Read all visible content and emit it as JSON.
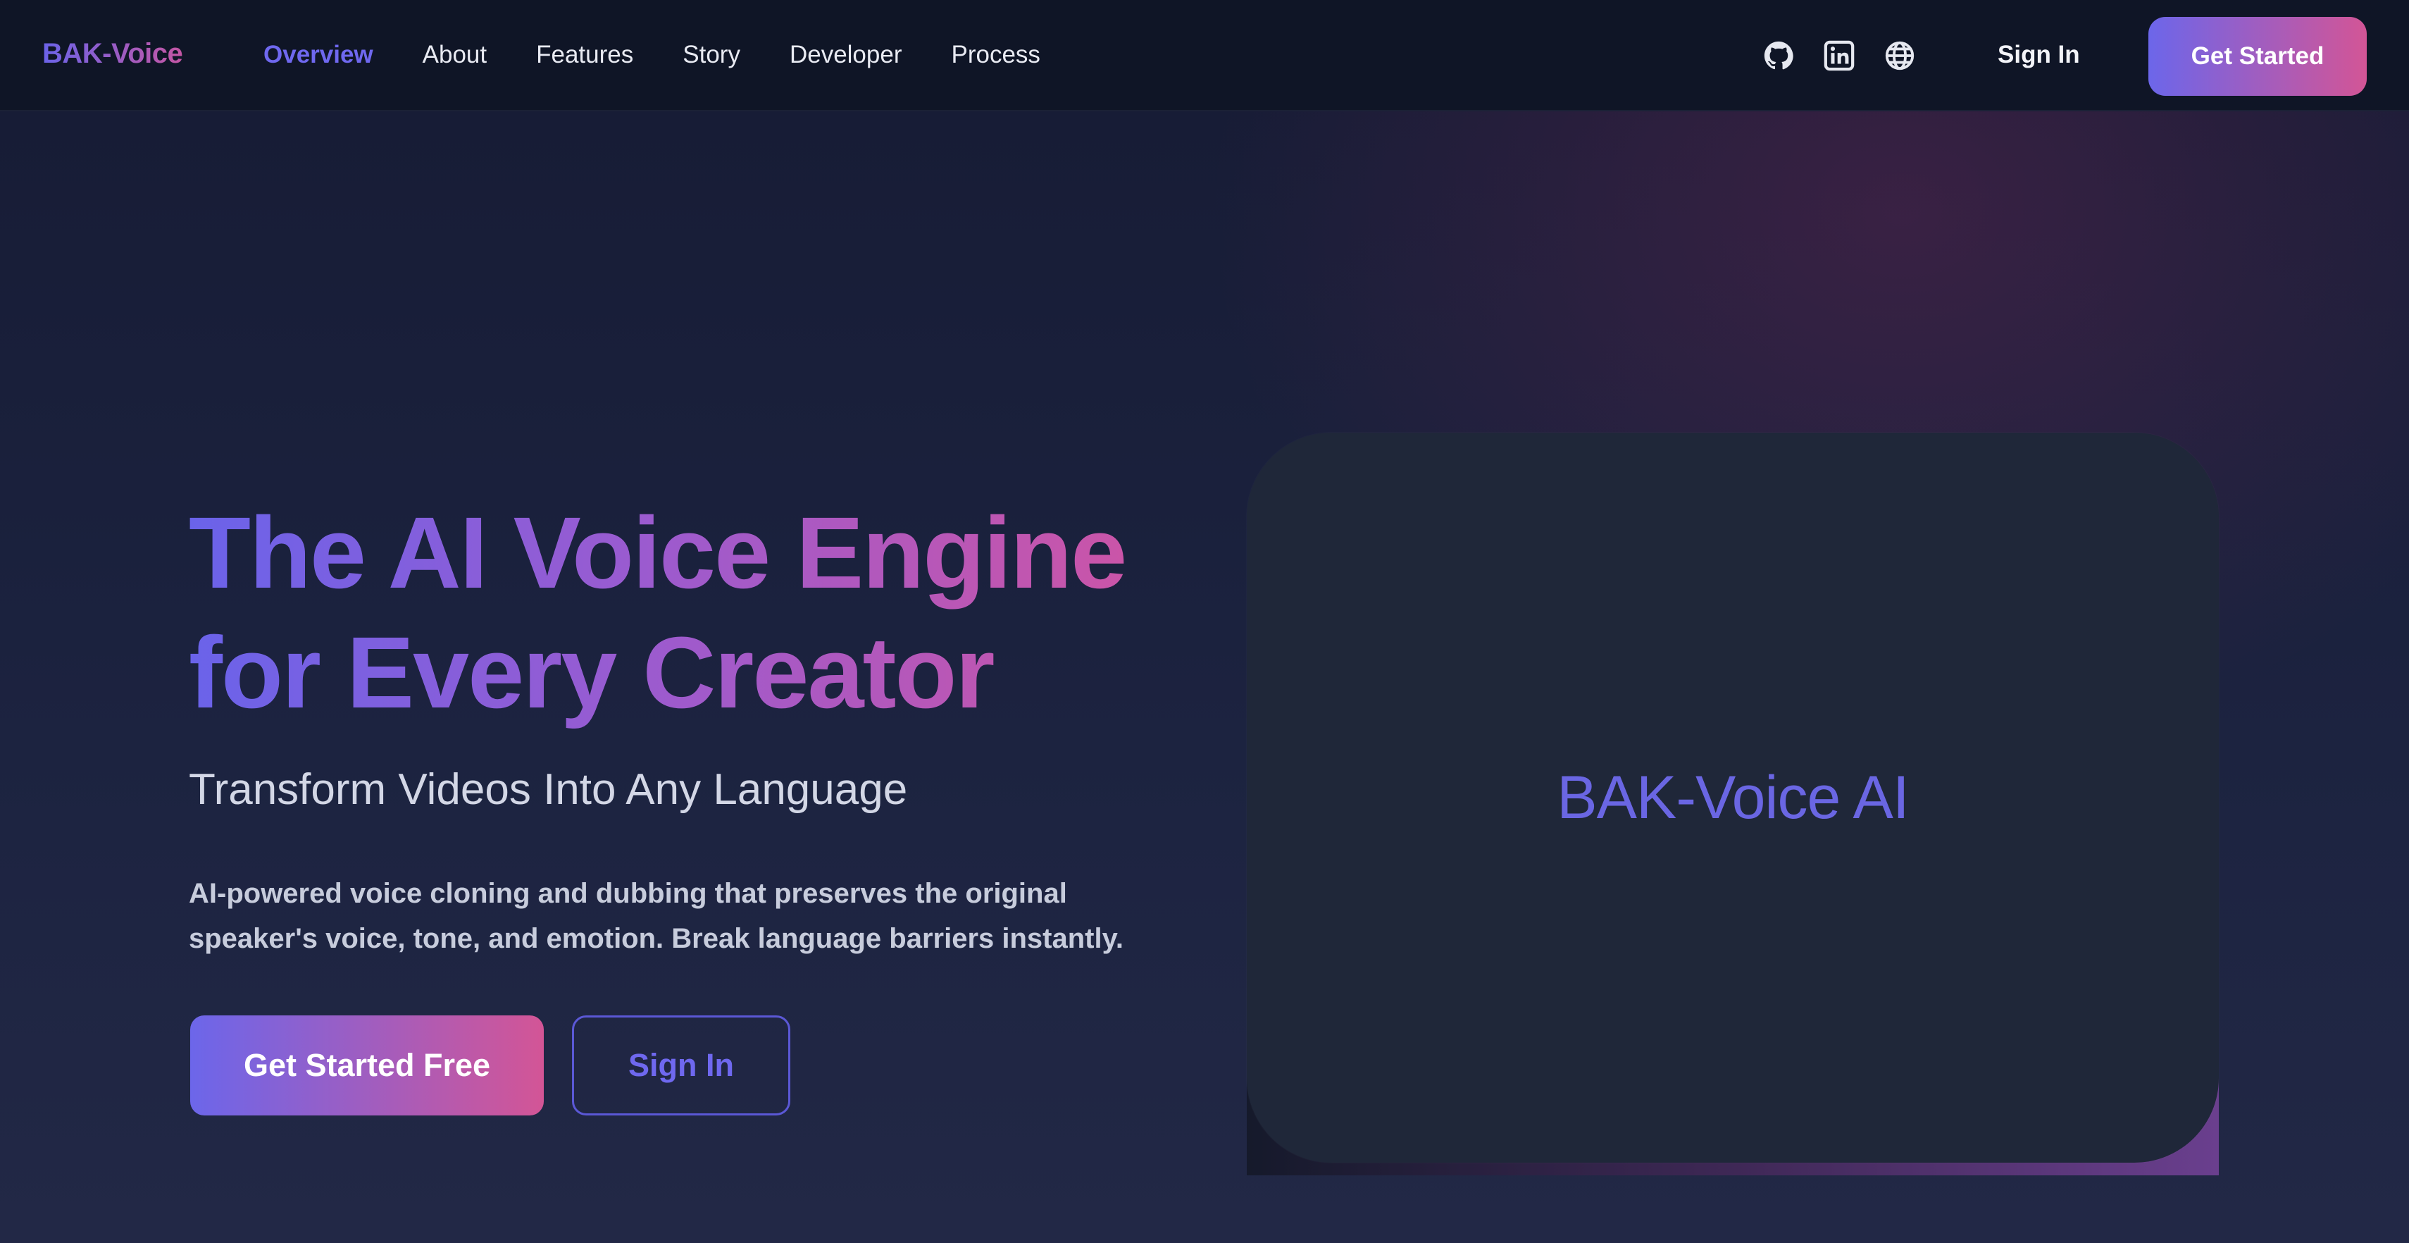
{
  "nav": {
    "logo": "BAK-Voice",
    "links": [
      "Overview",
      "About",
      "Features",
      "Story",
      "Developer",
      "Process"
    ],
    "active": "Overview",
    "icons": [
      "github-icon",
      "linkedin-icon",
      "globe-icon"
    ],
    "sign_in": "Sign In",
    "cta": "Get Started"
  },
  "hero": {
    "title_line1": "The AI Voice Engine",
    "title_line2": "for Every Creator",
    "subtitle": "Transform Videos Into Any Language",
    "description": "AI-powered voice cloning and dubbing that preserves the original speaker's voice, tone, and emotion. Break language barriers instantly.",
    "primary_button": "Get Started Free",
    "secondary_button": "Sign In"
  },
  "media": {
    "label": "BAK-Voice AI"
  },
  "colors": {
    "accent": "#6c66ea",
    "accent_pink": "#d35596",
    "nav_bg": "#0f1526",
    "card_bg": "#1f2739"
  }
}
